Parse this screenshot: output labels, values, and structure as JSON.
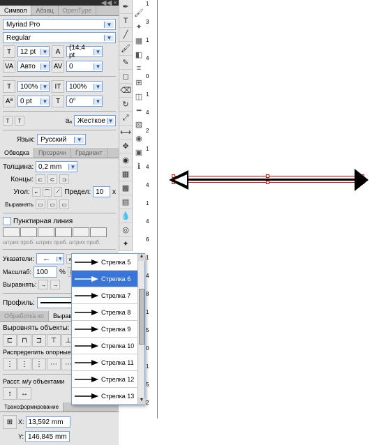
{
  "topBar": {
    "sep": "◀◀",
    "x": "×"
  },
  "charPanel": {
    "tabs": {
      "symbol": "Символ",
      "paragraph": "Абзац",
      "opentype": "OpenType"
    },
    "font": "Myriad Pro",
    "style": "Regular",
    "size": "12 pt",
    "leading": "(14,4 pt",
    "kerning": "Авто",
    "tracking": "0",
    "hscale": "100%",
    "vscale": "100%",
    "baseline": "0 pt",
    "rotation": "0°",
    "hintLabel": "Жесткое",
    "langLabel": "Язык:",
    "lang": "Русский"
  },
  "strokePanel": {
    "tabs": {
      "stroke": "Обводка",
      "transparency": "Прозрачн",
      "gradient": "Градиент"
    },
    "weightLabel": "Толщина:",
    "weight": "0,2 mm",
    "capsLabel": "Концы:",
    "angleLabel": "Угол:",
    "limitLabel": "Предел:",
    "limit": "10",
    "x": "x",
    "alignLabel": "Выравнять",
    "dashLabel": "Пунктирная линия",
    "dashLegend": "штрих проб. штрих проб. штрих проб.",
    "pointersLabel": "Указатели:",
    "scaleLabel": "Масштаб:",
    "scale": "100",
    "pct": "%",
    "alignArrowLabel": "Выравнять:",
    "profileLabel": "Профиль:"
  },
  "processPanel": {
    "tabs": {
      "process": "Обработка ко",
      "align": "Выравн"
    },
    "alignObjects": "Выровнять объекты:",
    "distribute": "Распределить опорные",
    "spacing": "Расст. м/у объектами"
  },
  "transformPanel": {
    "title": "Трансформирование",
    "xLabel": "X:",
    "x": "13,592 mm",
    "yLabel": "Y:",
    "y": "146,845 mm"
  },
  "ruler": [
    "1",
    "3",
    "1",
    "4",
    "0",
    "1",
    "4",
    "2",
    "1",
    "4",
    "4",
    "1",
    "4",
    "6",
    "1",
    "4",
    "8",
    "1",
    "5",
    "0",
    "1",
    "5",
    "2"
  ],
  "arrowList": [
    {
      "name": "Стрелка 5"
    },
    {
      "name": "Стрелка 6",
      "selected": true
    },
    {
      "name": "Стрелка 7"
    },
    {
      "name": "Стрелка 8"
    },
    {
      "name": "Стрелка 9"
    },
    {
      "name": "Стрелка 10"
    },
    {
      "name": "Стрелка 11"
    },
    {
      "name": "Стрелка 12"
    },
    {
      "name": "Стрелка 13"
    }
  ]
}
